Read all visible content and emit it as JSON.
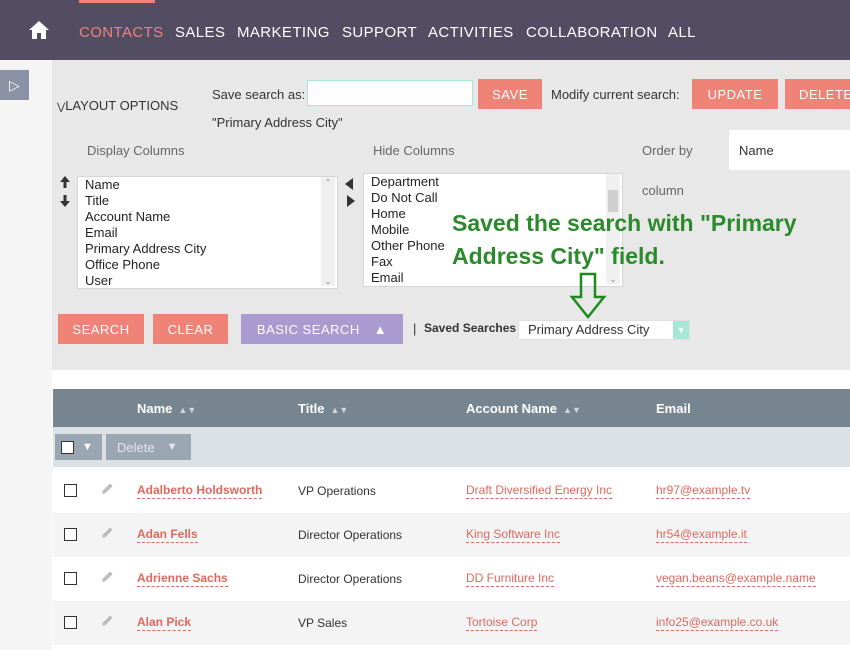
{
  "nav": {
    "items": [
      {
        "label": "CONTACTS",
        "active": true
      },
      {
        "label": "SALES"
      },
      {
        "label": "MARKETING"
      },
      {
        "label": "SUPPORT"
      },
      {
        "label": "ACTIVITIES"
      },
      {
        "label": "COLLABORATION"
      },
      {
        "label": "ALL"
      }
    ],
    "home_icon": "home-icon"
  },
  "sidebar": {
    "toggle_glyph": "▷"
  },
  "layout_options": {
    "label": "LAYOUT OPTIONS",
    "save_search_label": "Save search as:",
    "save_search_value": "",
    "save_button": "SAVE",
    "modify_label": "Modify current search:",
    "update_button": "UPDATE",
    "delete_button": "DELETE",
    "current_saved": "\"Primary Address City\"",
    "display_columns_label": "Display Columns",
    "hide_columns_label": "Hide Columns",
    "order_by_label": "Order by",
    "order_by_value": "Name",
    "order_by_suffix": "column",
    "display_columns": [
      "Name",
      "Title",
      "Account Name",
      "Email",
      "Primary Address City",
      "Office Phone",
      "User"
    ],
    "hide_columns": [
      "Department",
      "Do Not Call",
      "Home",
      "Mobile",
      "Other Phone",
      "Fax",
      "Email"
    ]
  },
  "annotation": {
    "line1": "Saved the search with \"Primary",
    "line2": "Address City\" field."
  },
  "actions": {
    "search": "SEARCH",
    "clear": "CLEAR",
    "basic_search": "BASIC SEARCH",
    "basic_search_glyph": "▲",
    "separator": "|",
    "saved_searches_label": "Saved Searches",
    "saved_searches_value": "Primary Address City"
  },
  "table": {
    "columns": [
      "Name",
      "Title",
      "Account Name",
      "Email"
    ],
    "bulk_delete": "Delete",
    "rows": [
      {
        "name": "Adalberto Holdsworth",
        "title": "VP Operations",
        "account": "Draft Diversified Energy Inc",
        "email": "hr97@example.tv"
      },
      {
        "name": "Adan Fells",
        "title": "Director Operations",
        "account": "King Software Inc",
        "email": "hr54@example.it"
      },
      {
        "name": "Adrienne Sachs",
        "title": "Director Operations",
        "account": "DD Furniture Inc",
        "email": "vegan.beans@example.name"
      },
      {
        "name": "Alan Pick",
        "title": "VP Sales",
        "account": "Tortoise Corp",
        "email": "info25@example.co.uk"
      }
    ]
  },
  "colors": {
    "accent": "#f08377",
    "nav_bg": "#534d64",
    "annotation": "#2b8a2b",
    "basic_search": "#a99ad0"
  }
}
